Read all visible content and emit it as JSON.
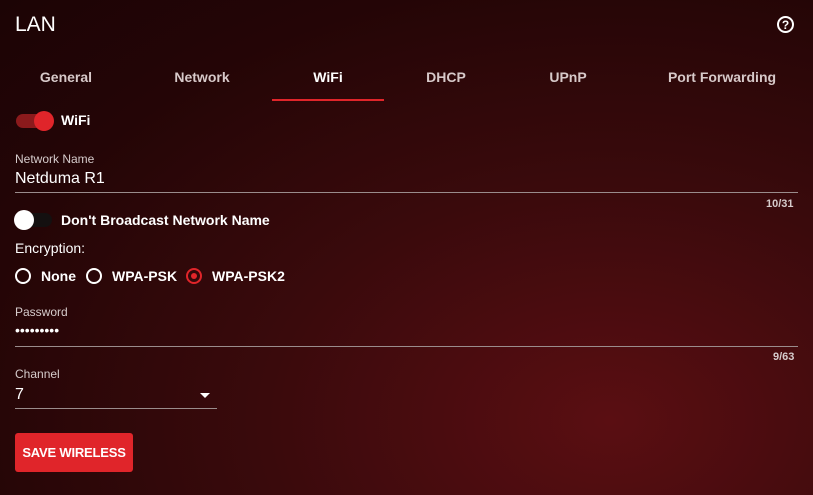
{
  "header": {
    "title": "LAN",
    "help_icon": "question-circle-icon",
    "help_glyph": "?"
  },
  "tabs": [
    {
      "label": "General"
    },
    {
      "label": "Network"
    },
    {
      "label": "WiFi",
      "active": true
    },
    {
      "label": "DHCP"
    },
    {
      "label": "UPnP"
    },
    {
      "label": "Port Forwarding"
    }
  ],
  "wifi_toggle": {
    "label": "WiFi",
    "on": true
  },
  "network_name": {
    "label": "Network Name",
    "value": "Netduma R1",
    "counter": "10/31"
  },
  "broadcast_toggle": {
    "label": "Don't Broadcast Network Name",
    "on": false
  },
  "encryption": {
    "label": "Encryption:",
    "options": [
      {
        "label": "None",
        "selected": false
      },
      {
        "label": "WPA-PSK",
        "selected": false
      },
      {
        "label": "WPA-PSK2",
        "selected": true
      }
    ]
  },
  "password": {
    "label": "Password",
    "value": "•••••••••",
    "counter": "9/63"
  },
  "channel": {
    "label": "Channel",
    "value": "7"
  },
  "save_button": {
    "label": "SAVE WIRELESS"
  },
  "colors": {
    "accent": "#e0252a",
    "background": "#2a0608"
  }
}
